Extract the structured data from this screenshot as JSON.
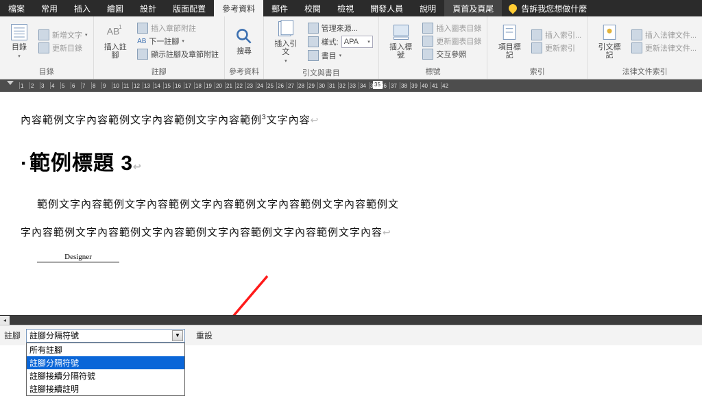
{
  "tell_me": "告訴我您想做什麼",
  "menu": [
    "檔案",
    "常用",
    "插入",
    "繪圖",
    "設計",
    "版面配置",
    "參考資料",
    "郵件",
    "校閱",
    "檢視",
    "開發人員",
    "說明",
    "頁首及頁尾"
  ],
  "menu_active_index": 6,
  "menu_special_index": 12,
  "ribbon": {
    "g1": {
      "label": "目錄",
      "toc": "目錄",
      "add_text": "新增文字",
      "update_toc": "更新目錄"
    },
    "g2": {
      "label": "註腳",
      "insert_fn": "插入註腳",
      "ab": "AB",
      "next_fn": "下一註腳",
      "insert_en": "插入章節附註",
      "show_notes": "顯示註腳及章節附註"
    },
    "g3": {
      "label": "參考資料",
      "search": "搜尋"
    },
    "g4": {
      "label": "引文與書目",
      "insert_cite": "插入引文",
      "manage": "管理來源...",
      "style": "樣式:",
      "style_val": "APA",
      "bib": "書目"
    },
    "g5": {
      "label": "標號",
      "caption": "插入標號",
      "fig_toc": "插入圖表目錄",
      "update_fig": "更新圖表目錄",
      "xref": "交互參照"
    },
    "g6": {
      "label": "索引",
      "mark": "項目標記",
      "insert_idx": "插入索引...",
      "update_idx": "更新索引"
    },
    "g7": {
      "label": "法律文件索引",
      "mark_cit": "引文標記",
      "insert_auth": "插入法律文件...",
      "update_auth": "更新法律文件..."
    }
  },
  "doc": {
    "p1a": "內容範例文字內容範例文字內容範例文字內容範例",
    "p1b": "文字內容",
    "sup": "3",
    "h": "範例標題 3",
    "p2": "範例文字內容範例文字內容範例文字內容範例文字內容範例文字內容範例文",
    "p3": "字內容範例文字內容範例文字內容範例文字內容範例文字內容範例文字內容",
    "designer": "Designer"
  },
  "pane": {
    "label": "註腳",
    "selected": "註腳分隔符號",
    "options": [
      "所有註腳",
      "註腳分隔符號",
      "註腳接續分隔符號",
      "註腳接續註明"
    ],
    "sel_index": 1,
    "reset": "重設"
  },
  "ruler_ticks": [
    1,
    2,
    3,
    4,
    5,
    6,
    7,
    8,
    9,
    10,
    11,
    12,
    13,
    14,
    15,
    16,
    17,
    18,
    19,
    20,
    21,
    22,
    23,
    24,
    25,
    26,
    27,
    28,
    29,
    30,
    31,
    32,
    33,
    34,
    35,
    36,
    37,
    38,
    39,
    40,
    41,
    42
  ],
  "ruler_hl": "35"
}
